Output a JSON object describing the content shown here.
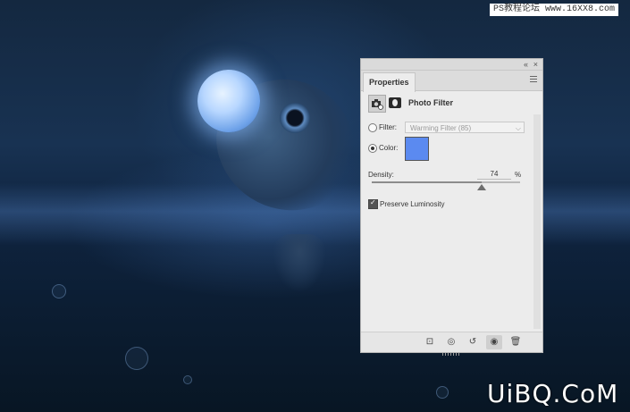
{
  "watermark": {
    "top": "PS教程论坛 www.16XX8.com",
    "bottom": "UiBQ.CoM"
  },
  "panel": {
    "top_controls": {
      "collapse": "«",
      "close": "×"
    },
    "tab_label": "Properties",
    "menu_icon": "panel-menu-icon",
    "adjustment_title": "Photo Filter",
    "filter": {
      "label": "Filter:",
      "selected": false,
      "value": "Warming Filter (85)"
    },
    "color": {
      "label": "Color:",
      "selected": true,
      "swatch_hex": "#5b8af0"
    },
    "density": {
      "label": "Density:",
      "value": "74",
      "unit": "%",
      "level": 0.74
    },
    "preserve_luminosity": {
      "label": "Preserve Luminosity",
      "checked": true
    },
    "footer_icons": [
      "clip-to-layer-icon",
      "view-previous-state-icon",
      "reset-icon",
      "visibility-eye-icon",
      "trash-icon"
    ]
  }
}
